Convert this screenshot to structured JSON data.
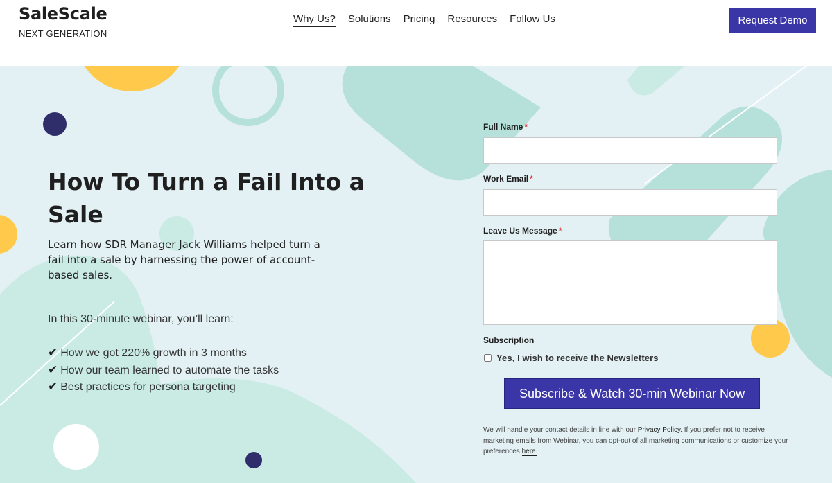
{
  "brand": {
    "name": "SaleScale",
    "tagline": "NEXT GENERATION"
  },
  "nav": {
    "items": [
      {
        "label": "Why Us?",
        "active": true
      },
      {
        "label": "Solutions",
        "active": false
      },
      {
        "label": "Pricing",
        "active": false
      },
      {
        "label": "Resources",
        "active": false
      },
      {
        "label": "Follow Us",
        "active": false
      }
    ],
    "cta_label": "Request Demo"
  },
  "hero": {
    "headline": "How To Turn a Fail Into a Sale",
    "intro": "Learn how SDR Manager Jack Williams helped turn a fail into a sale by harnessing the power of account-based sales.",
    "learn_title": "In this 30-minute webinar, you’ll learn:",
    "check_glyph": "✔",
    "benefits": [
      "How we got 220% growth in 3 months",
      "How our team learned to automate the tasks",
      "Best practices for persona targeting"
    ]
  },
  "form": {
    "full_name_label": "Full Name",
    "work_email_label": "Work Email",
    "message_label": "Leave Us Message",
    "required_mark": "*",
    "full_name_value": "",
    "work_email_value": "",
    "message_value": "",
    "subscription_label": "Subscription",
    "newsletter_label": "Yes, I wish to receive the Newsletters",
    "newsletter_checked": false,
    "submit_label": "Subscribe & Watch 30-min Webinar Now",
    "privacy_part1": "We will handle your contact details in line with our ",
    "privacy_link": "Privacy Policy.",
    "privacy_part2": " If you prefer not to receive marketing emails from Webinar, you can ",
    "optout_link": "opt-out",
    "privacy_part3": " of all marketing communications or customize your preferences ",
    "here_link": "here."
  },
  "colors": {
    "accent": "#3b36a8",
    "hero_bg": "#e3f1f4",
    "mint": "#b5e1da",
    "light_mint": "#c9ebe3",
    "yellow": "#ffc94b",
    "navy_dot": "#2f2e6b"
  }
}
